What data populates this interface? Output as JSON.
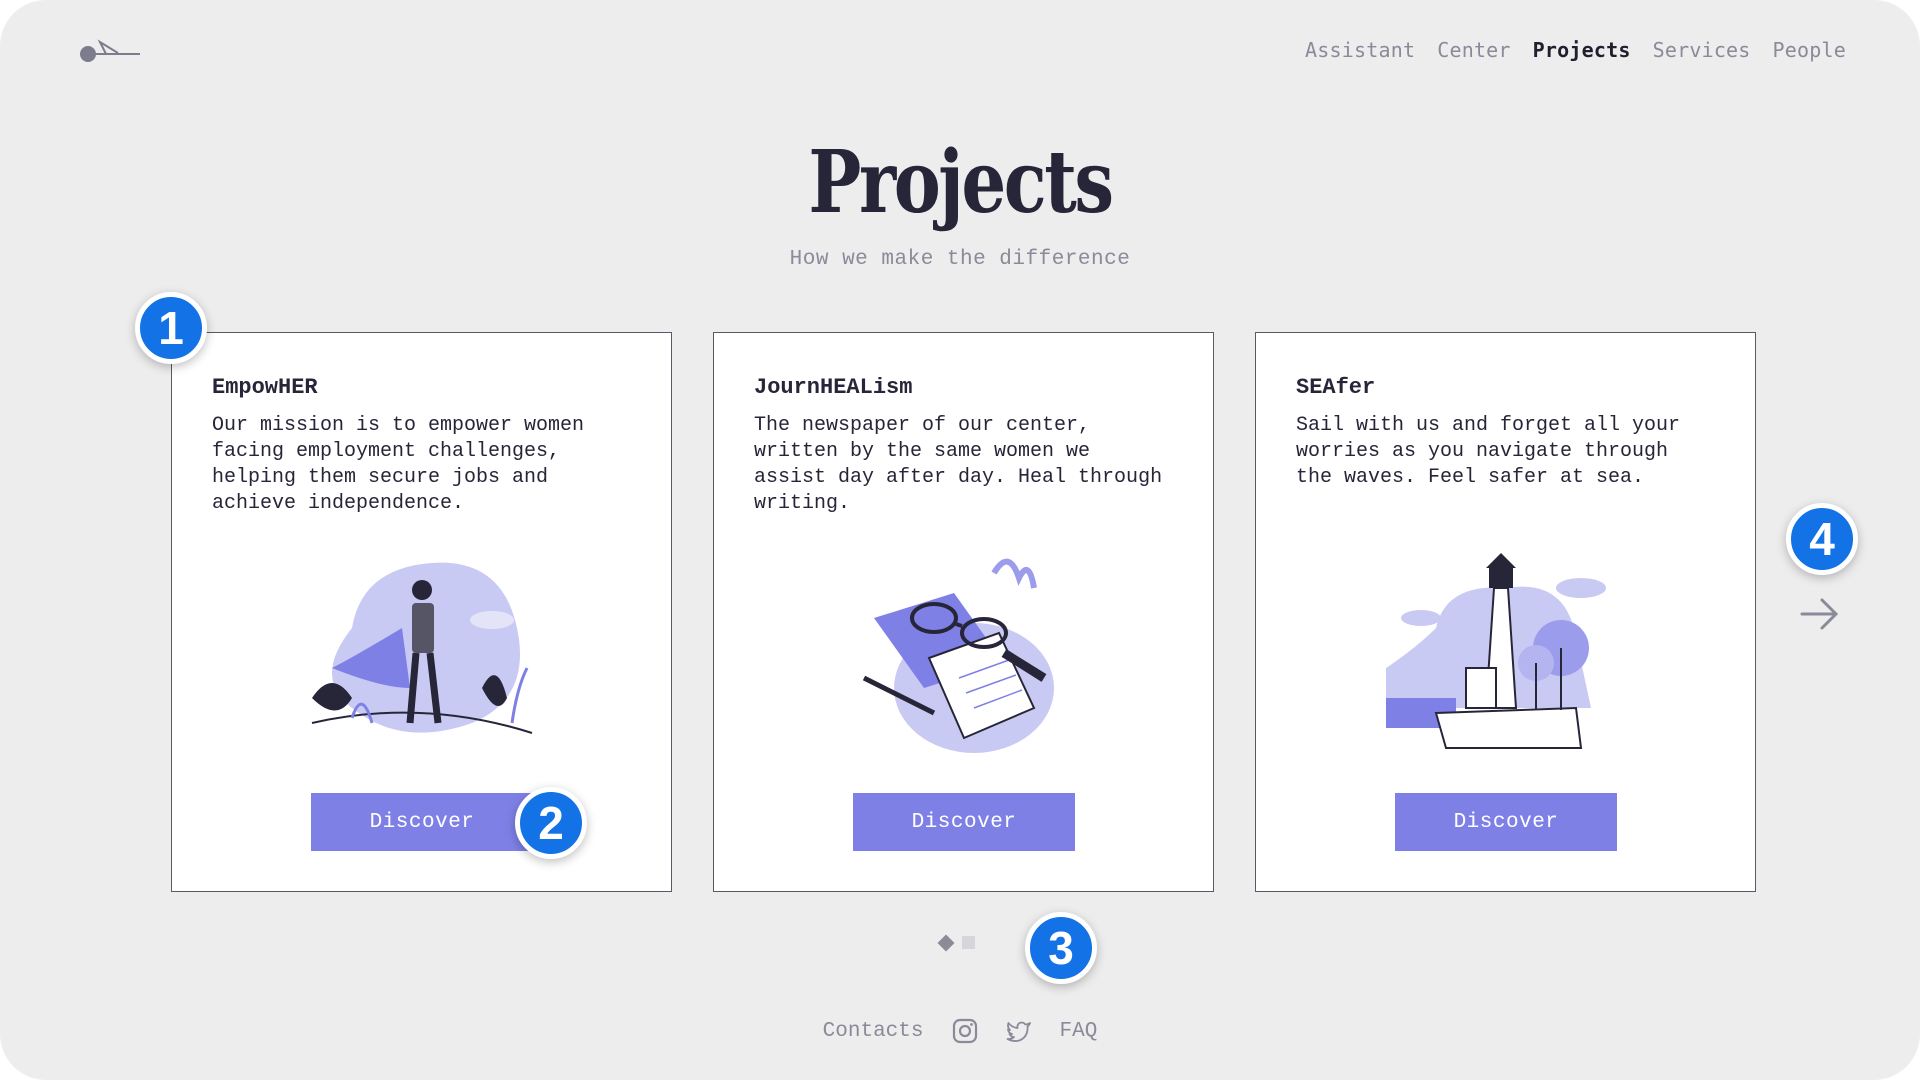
{
  "nav": {
    "items": [
      {
        "label": "Assistant",
        "active": false
      },
      {
        "label": "Center",
        "active": false
      },
      {
        "label": "Projects",
        "active": true
      },
      {
        "label": "Services",
        "active": false
      },
      {
        "label": "People",
        "active": false
      }
    ]
  },
  "header": {
    "title": "Projects",
    "subtitle": "How we make the difference"
  },
  "cards": [
    {
      "title": "EmpowHER",
      "description": "Our mission is to empower women\nfacing employment challenges,\nhelping them secure jobs and\nachieve independence.",
      "button_label": "Discover",
      "illustration": "superhero-woman-illustration"
    },
    {
      "title": "JournHEALism",
      "description": "The newspaper of our center,\nwritten by the same women we\nassist day after day. Heal through\nwriting.",
      "button_label": "Discover",
      "illustration": "notebook-glasses-illustration"
    },
    {
      "title": "SEAfer",
      "description": "Sail with us and forget all your\nworries as you navigate through\nthe waves. Feel safer at sea.",
      "button_label": "Discover",
      "illustration": "lighthouse-illustration"
    }
  ],
  "pagination": {
    "current": 1,
    "total": 2
  },
  "footer": {
    "contacts_label": "Contacts",
    "faq_label": "FAQ",
    "icons": [
      "instagram-icon",
      "twitter-icon"
    ]
  },
  "badges": [
    "1",
    "2",
    "3",
    "4"
  ],
  "colors": {
    "accent": "#7e80e6",
    "background": "#ededee",
    "card": "#ffffff",
    "text": "#262638",
    "muted": "#8a8a99",
    "badge": "#1272e6"
  }
}
